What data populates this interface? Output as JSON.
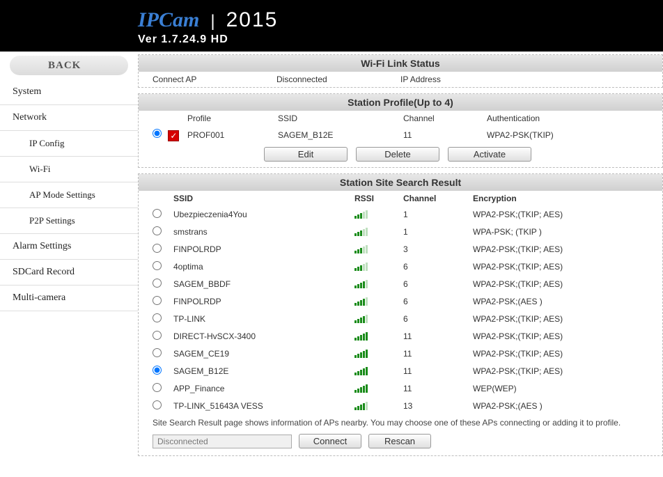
{
  "brand": "IPCam",
  "year": "2015",
  "version": "Ver  1.7.24.9 HD",
  "nav": {
    "back": "BACK",
    "system": "System",
    "network": "Network",
    "ipconfig": "IP Config",
    "wifi": "Wi-Fi",
    "apmode": "AP Mode Settings",
    "p2p": "P2P Settings",
    "alarm": "Alarm Settings",
    "sdcard": "SDCard Record",
    "multi": "Multi-camera"
  },
  "wifilink": {
    "title": "Wi-Fi Link Status",
    "connectap_label": "Connect AP",
    "connectap_value": "Disconnected",
    "ipaddress_label": "IP Address",
    "ipaddress_value": ""
  },
  "profile": {
    "title": "Station Profile(Up to 4)",
    "headers": {
      "profile": "Profile",
      "ssid": "SSID",
      "channel": "Channel",
      "auth": "Authentication"
    },
    "row": {
      "name": "PROF001",
      "ssid": "SAGEM_B12E",
      "channel": "11",
      "auth": "WPA2-PSK(TKIP)"
    },
    "buttons": {
      "edit": "Edit",
      "delete": "Delete",
      "activate": "Activate"
    }
  },
  "search": {
    "title": "Station Site Search Result",
    "headers": {
      "ssid": "SSID",
      "rssi": "RSSI",
      "channel": "Channel",
      "encryption": "Encryption"
    },
    "rows": [
      {
        "ssid": "Ubezpieczenia4You",
        "rssi": 3,
        "channel": "1",
        "encryption": "WPA2-PSK;(TKIP; AES)",
        "selected": false
      },
      {
        "ssid": "smstrans",
        "rssi": 3,
        "channel": "1",
        "encryption": "WPA-PSK; (TKIP )",
        "selected": false
      },
      {
        "ssid": "FINPOLRDP",
        "rssi": 3,
        "channel": "3",
        "encryption": "WPA2-PSK;(TKIP; AES)",
        "selected": false
      },
      {
        "ssid": "4optima",
        "rssi": 3,
        "channel": "6",
        "encryption": "WPA2-PSK;(TKIP; AES)",
        "selected": false
      },
      {
        "ssid": "SAGEM_BBDF",
        "rssi": 4,
        "channel": "6",
        "encryption": "WPA2-PSK;(TKIP; AES)",
        "selected": false
      },
      {
        "ssid": "FINPOLRDP",
        "rssi": 4,
        "channel": "6",
        "encryption": "WPA2-PSK;(AES )",
        "selected": false
      },
      {
        "ssid": "TP-LINK",
        "rssi": 4,
        "channel": "6",
        "encryption": "WPA2-PSK;(TKIP; AES)",
        "selected": false
      },
      {
        "ssid": "DIRECT-HvSCX-3400",
        "rssi": 5,
        "channel": "11",
        "encryption": "WPA2-PSK;(TKIP; AES)",
        "selected": false
      },
      {
        "ssid": "SAGEM_CE19",
        "rssi": 5,
        "channel": "11",
        "encryption": "WPA2-PSK;(TKIP; AES)",
        "selected": false
      },
      {
        "ssid": "SAGEM_B12E",
        "rssi": 5,
        "channel": "11",
        "encryption": "WPA2-PSK;(TKIP; AES)",
        "selected": true
      },
      {
        "ssid": "APP_Finance",
        "rssi": 5,
        "channel": "11",
        "encryption": "WEP(WEP)",
        "selected": false
      },
      {
        "ssid": "TP-LINK_51643A VESS",
        "rssi": 4,
        "channel": "13",
        "encryption": "WPA2-PSK;(AES )",
        "selected": false
      }
    ],
    "hint": "Site Search Result page shows information of APs nearby. You may choose one of these APs connecting or adding it to profile.",
    "status": "Disconnected",
    "buttons": {
      "connect": "Connect",
      "rescan": "Rescan"
    }
  }
}
